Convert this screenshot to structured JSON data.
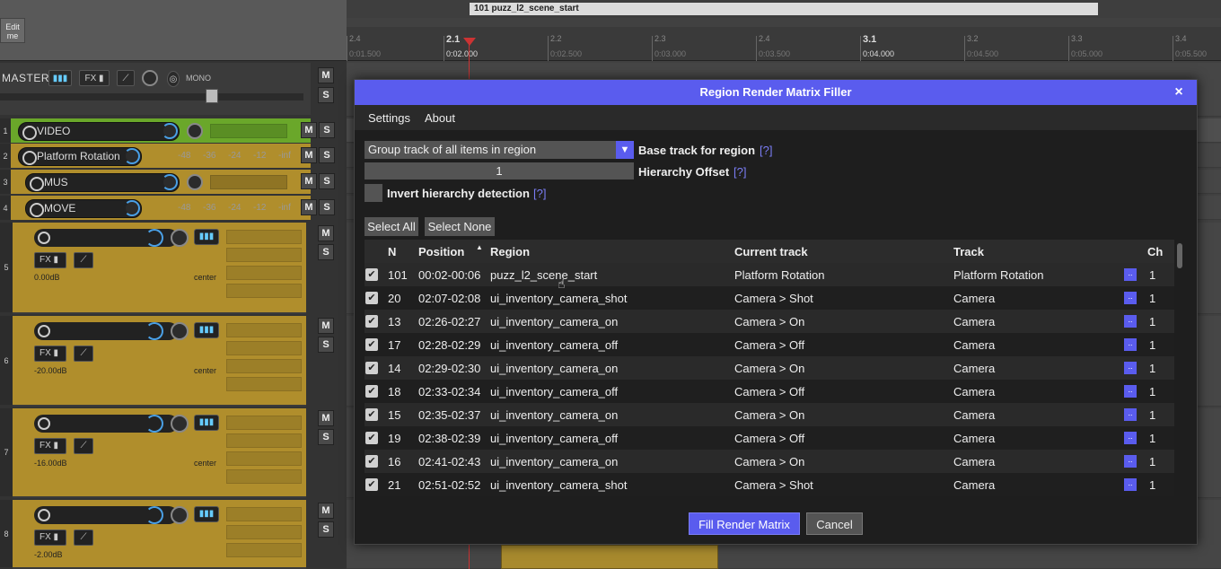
{
  "colors": {
    "accent": "#5a5cee",
    "track_gold": "#b08e2c",
    "video_green": "#6aa72a"
  },
  "tcp": {
    "edit_me": "Edit me",
    "master": {
      "label": "MASTER",
      "fx": "FX",
      "mono": "MONO"
    },
    "tracks": [
      {
        "num": "1",
        "name": "VIDEO",
        "m": "M",
        "s": "S"
      },
      {
        "num": "2",
        "name": "Platform Rotation",
        "m": "M",
        "s": "S"
      },
      {
        "num": "3",
        "name": "MUS",
        "m": "M",
        "s": "S"
      },
      {
        "num": "4",
        "name": "MOVE",
        "m": "M",
        "s": "S"
      }
    ],
    "db_scale": [
      "-48",
      "-36",
      "-24",
      "-12",
      "-inf"
    ],
    "big_tracks": [
      {
        "num": "5",
        "fx": "FX",
        "vol": "0.00dB",
        "pan": "center",
        "m": "M",
        "s": "S"
      },
      {
        "num": "6",
        "fx": "FX",
        "vol": "-20.00dB",
        "pan": "center",
        "m": "M",
        "s": "S"
      },
      {
        "num": "7",
        "fx": "FX",
        "vol": "-16.00dB",
        "pan": "center",
        "m": "M",
        "s": "S"
      },
      {
        "num": "8",
        "fx": "FX",
        "vol": "-2.00dB",
        "pan": "",
        "m": "M",
        "s": "S"
      }
    ]
  },
  "arrange": {
    "region_name": "101 puzz_l2_scene_start",
    "ruler": [
      {
        "label": "2.4",
        "sub": "0:01.500",
        "major": false
      },
      {
        "label": "2.1",
        "sub": "0:02.000",
        "major": true
      },
      {
        "label": "2.2",
        "sub": "0:02.500",
        "major": false
      },
      {
        "label": "2.3",
        "sub": "0:03.000",
        "major": false
      },
      {
        "label": "2.4",
        "sub": "0:03.500",
        "major": false
      },
      {
        "label": "3.1",
        "sub": "0:04.000",
        "major": true
      },
      {
        "label": "3.2",
        "sub": "0:04.500",
        "major": false
      },
      {
        "label": "3.3",
        "sub": "0:05.000",
        "major": false
      },
      {
        "label": "3.4",
        "sub": "0:05.500",
        "major": false
      }
    ]
  },
  "dialog": {
    "title": "Region Render Matrix Filler",
    "close": "×",
    "menu": {
      "settings": "Settings",
      "about": "About"
    },
    "base_track": {
      "value": "Group track of all items in region",
      "arrow": "▼",
      "label": "Base track for region",
      "help": "[?]"
    },
    "hierarchy_offset": {
      "value": "1",
      "label": "Hierarchy Offset",
      "help": "[?]"
    },
    "invert": {
      "label": "Invert hierarchy detection",
      "help": "[?]"
    },
    "select_all": "Select All",
    "select_none": "Select None",
    "columns": {
      "n": "N",
      "position": "Position",
      "sort": "▲",
      "region": "Region",
      "current_track": "Current track",
      "track": "Track",
      "ch": "Ch"
    },
    "rows": [
      {
        "check": "✔",
        "n": "101",
        "position": "00:02-00:06",
        "region": "puzz_l2_scene_start",
        "current": "Platform Rotation",
        "track": "Platform Rotation",
        "btn": "..",
        "ch": "1"
      },
      {
        "check": "✔",
        "n": "20",
        "position": "02:07-02:08",
        "region": "ui_inventory_camera_shot",
        "current": "Camera > Shot",
        "track": "Camera",
        "btn": "..",
        "ch": "1"
      },
      {
        "check": "✔",
        "n": "13",
        "position": "02:26-02:27",
        "region": "ui_inventory_camera_on",
        "current": "Camera > On",
        "track": "Camera",
        "btn": "..",
        "ch": "1"
      },
      {
        "check": "✔",
        "n": "17",
        "position": "02:28-02:29",
        "region": "ui_inventory_camera_off",
        "current": "Camera > Off",
        "track": "Camera",
        "btn": "..",
        "ch": "1"
      },
      {
        "check": "✔",
        "n": "14",
        "position": "02:29-02:30",
        "region": "ui_inventory_camera_on",
        "current": "Camera > On",
        "track": "Camera",
        "btn": "..",
        "ch": "1"
      },
      {
        "check": "✔",
        "n": "18",
        "position": "02:33-02:34",
        "region": "ui_inventory_camera_off",
        "current": "Camera > Off",
        "track": "Camera",
        "btn": "..",
        "ch": "1"
      },
      {
        "check": "✔",
        "n": "15",
        "position": "02:35-02:37",
        "region": "ui_inventory_camera_on",
        "current": "Camera > On",
        "track": "Camera",
        "btn": "..",
        "ch": "1"
      },
      {
        "check": "✔",
        "n": "19",
        "position": "02:38-02:39",
        "region": "ui_inventory_camera_off",
        "current": "Camera > Off",
        "track": "Camera",
        "btn": "..",
        "ch": "1"
      },
      {
        "check": "✔",
        "n": "16",
        "position": "02:41-02:43",
        "region": "ui_inventory_camera_on",
        "current": "Camera > On",
        "track": "Camera",
        "btn": "..",
        "ch": "1"
      },
      {
        "check": "✔",
        "n": "21",
        "position": "02:51-02:52",
        "region": "ui_inventory_camera_shot",
        "current": "Camera > Shot",
        "track": "Camera",
        "btn": "..",
        "ch": "1"
      }
    ],
    "fill_button": "Fill Render Matrix",
    "cancel_button": "Cancel"
  }
}
